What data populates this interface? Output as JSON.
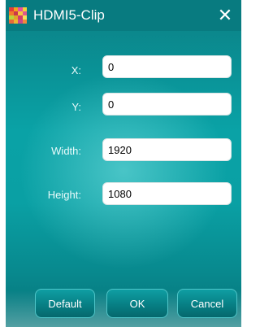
{
  "window": {
    "title": "HDMI5-Clip",
    "app_icon": "colorful-grid-icon",
    "close_symbol": "✕"
  },
  "fields": {
    "x": {
      "label": "X:",
      "value": "0"
    },
    "y": {
      "label": "Y:",
      "value": "0"
    },
    "width": {
      "label": "Width:",
      "value": "1920"
    },
    "height": {
      "label": "Height:",
      "value": "1080"
    }
  },
  "buttons": {
    "default_label": "Default",
    "ok_label": "OK",
    "cancel_label": "Cancel"
  },
  "colors": {
    "titlebar": "#087b80",
    "body_teal": "#0aa2a6",
    "text": "#ffffff"
  }
}
